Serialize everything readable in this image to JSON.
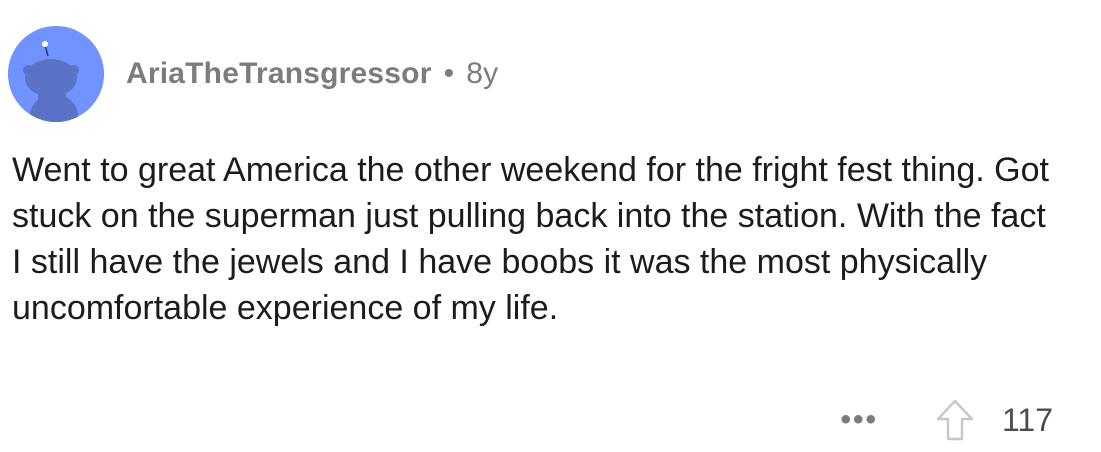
{
  "comment": {
    "author": "AriaTheTransgressor",
    "separator": "•",
    "age": "8y",
    "body": "Went to great America the other weekend for the fright fest thing. Got stuck on the superman just pulling back into the station. With the fact I still have the jewels and I have boobs it was the most physically uncomfortable experience of my life.",
    "score": "117",
    "more_label": "•••",
    "avatar_icon": "snoo-avatar-icon",
    "upvote_icon": "upvote-arrow-icon"
  },
  "colors": {
    "avatar_bg": "#7193ff",
    "avatar_figure": "#5a73c7",
    "meta_text": "#7c7c7c",
    "body_text": "#1c1c1c",
    "score_text": "#4d4d4d"
  }
}
